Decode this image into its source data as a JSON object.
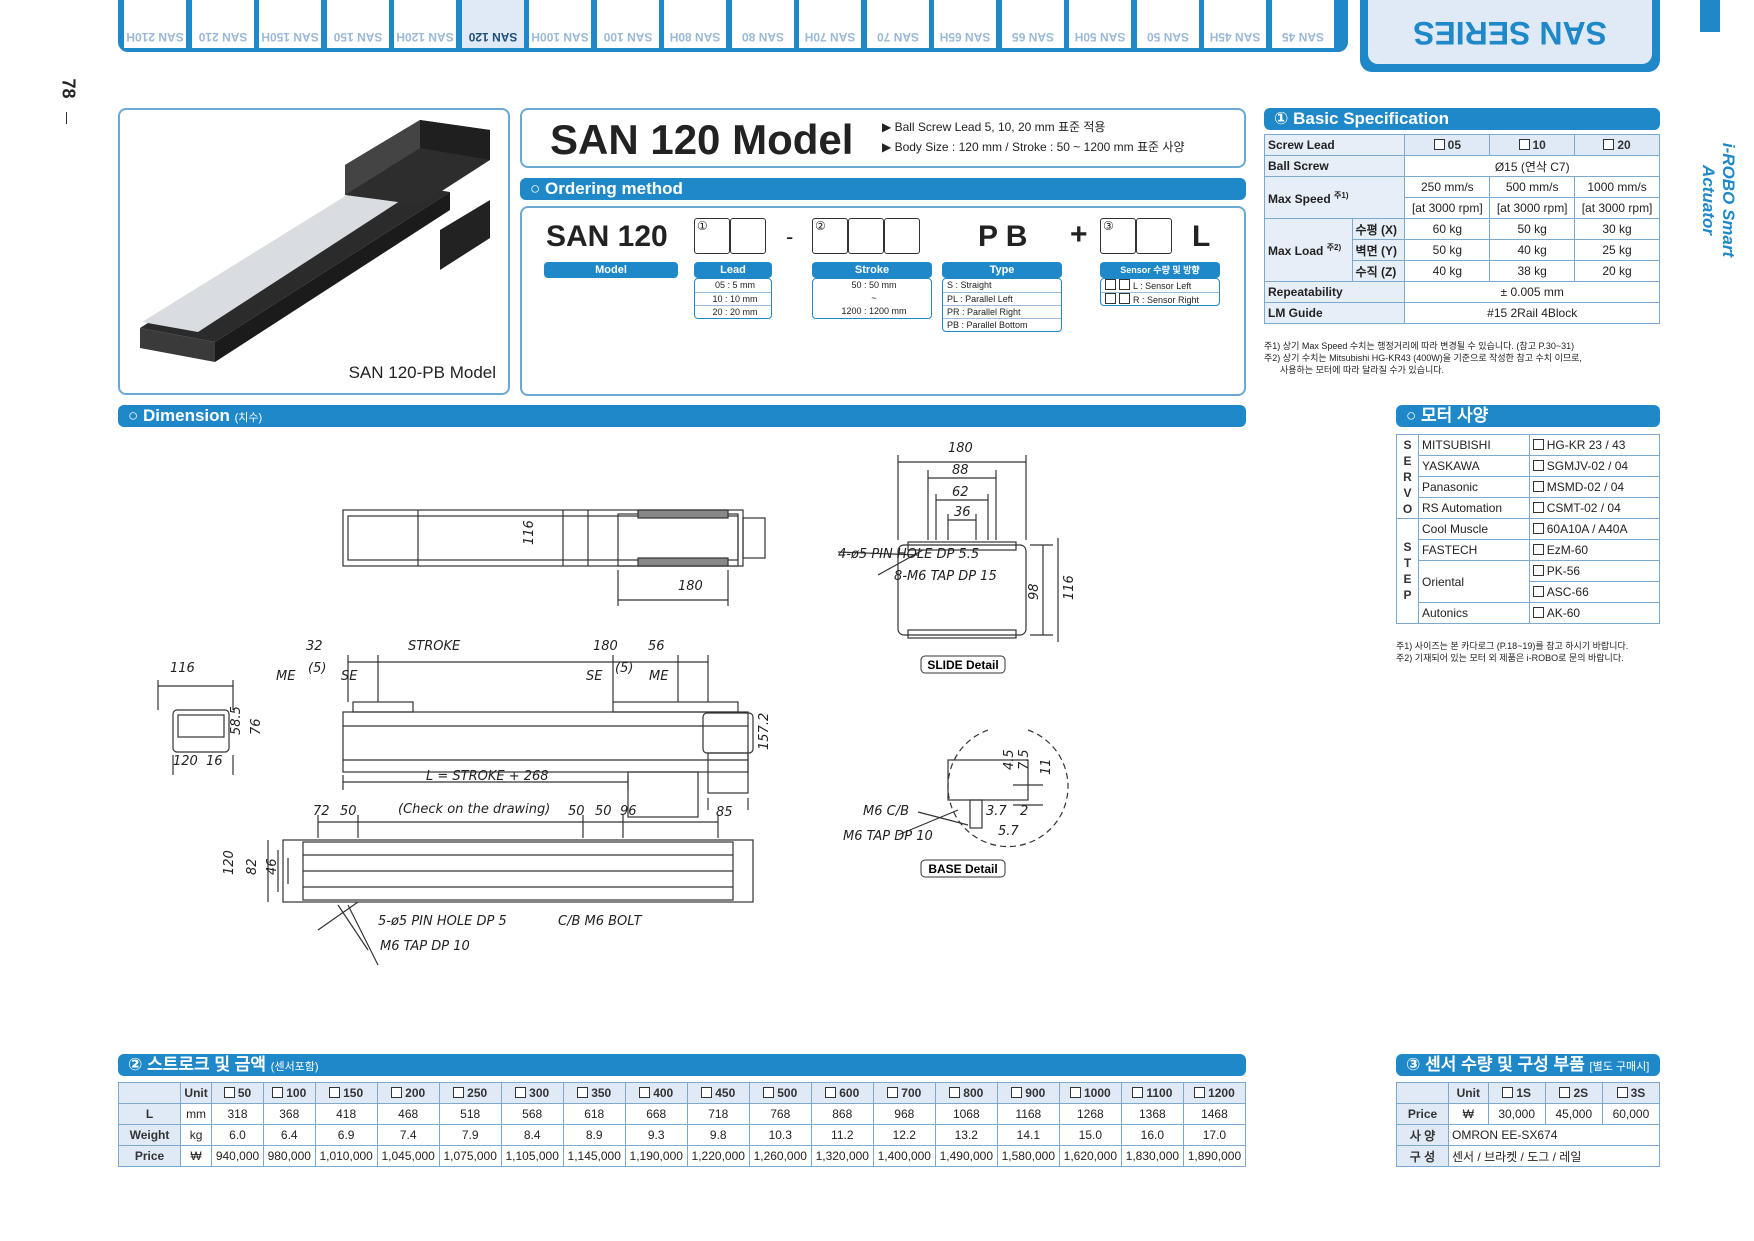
{
  "page_number": "78",
  "side_brand": "i-ROBO Smart Actuator",
  "series_banner": "SAN SERIES",
  "series_strip_label": "SAN SERIES",
  "tabs": [
    "SAN 210H",
    "SAN 210",
    "SAN 150H",
    "SAN 150",
    "SAN 120H",
    "SAN 120",
    "SAN 100H",
    "SAN 100",
    "SAN 80H",
    "SAN 80",
    "SAN 70H",
    "SAN 70",
    "SAN 65H",
    "SAN 65",
    "SAN 50H",
    "SAN 50",
    "SAN 45H",
    "SAN 45"
  ],
  "active_tab": "SAN 120",
  "product_caption": "SAN 120-PB Model",
  "model_title": "SAN 120 Model",
  "model_notes": [
    "▶ Ball Screw Lead 5, 10, 20 mm 표준 적용",
    "▶ Body Size : 120 mm / Stroke : 50 ~ 1200 mm 표준 사양"
  ],
  "ordering": {
    "title": "Ordering method",
    "code_prefix": "SAN 120",
    "dash": "-",
    "type_code": "P B",
    "plus": "+",
    "suffix": "L",
    "circle1": "①",
    "circle2": "②",
    "circle3": "③",
    "labels": {
      "model": "Model",
      "lead": "Lead",
      "stroke": "Stroke",
      "type": "Type",
      "sensor": "Sensor 수량 및 방향"
    },
    "lead_options": [
      "05 : 5 mm",
      "10 : 10 mm",
      "20 : 20 mm"
    ],
    "stroke_options": [
      "50 : 50 mm",
      "~",
      "1200 : 1200 mm"
    ],
    "type_options": [
      "S : Straight",
      "PL : Parallel Left",
      "PR : Parallel Right",
      "PB : Parallel Bottom"
    ],
    "sensor_options": [
      "L : Sensor Left",
      "R : Sensor Right"
    ]
  },
  "basic_spec": {
    "title": "① Basic Specification",
    "screw_lead_label": "Screw Lead",
    "leads": [
      "05",
      "10",
      "20"
    ],
    "ball_screw_label": "Ball Screw",
    "ball_screw": "Ø15 (연삭 C7)",
    "max_speed_label": "Max Speed",
    "max_speed_note": "주1)",
    "max_speed": [
      "250 mm/s",
      "500 mm/s",
      "1000 mm/s"
    ],
    "max_speed_rpm": [
      "[at 3000 rpm]",
      "[at 3000 rpm]",
      "[at 3000 rpm]"
    ],
    "max_load_label": "Max Load",
    "max_load_note": "주2)",
    "load_rows": [
      {
        "dir": "수평 (X)",
        "values": [
          "60 kg",
          "50 kg",
          "30 kg"
        ]
      },
      {
        "dir": "벽면 (Y)",
        "values": [
          "50 kg",
          "40 kg",
          "25 kg"
        ]
      },
      {
        "dir": "수직 (Z)",
        "values": [
          "40 kg",
          "38 kg",
          "20 kg"
        ]
      }
    ],
    "repeatability_label": "Repeatability",
    "repeatability": "± 0.005 mm",
    "lm_guide_label": "LM Guide",
    "lm_guide": "#15 2Rail 4Block",
    "notes": [
      "주1) 상기 Max Speed 수치는 행정거리에 따라 변경될 수 있습니다. (참고 P.30~31)",
      "주2) 상기 수치는 Mitsubishi HG-KR43 (400W)을 기준으로 작성한 참고 수치 이므로,",
      "사용하는 모터에 따라 달라질 수가 있습니다."
    ]
  },
  "dimension": {
    "title": "Dimension",
    "title_sub": "(치수)",
    "labels": {
      "d116": "116",
      "d180": "180",
      "d32": "32",
      "stroke": "STROKE",
      "d180b": "180",
      "d56": "56",
      "me": "ME",
      "se": "SE",
      "p5": "(5)",
      "d116b": "116",
      "d58": "58.5",
      "d76": "76",
      "d120": "120",
      "d16": "16",
      "l_formula": "L = STROKE + 268",
      "d157": "157.2",
      "d85": "85",
      "d72": "72",
      "d50": "50",
      "check": "(Check on the drawing)",
      "d50b": "50",
      "d50c": "50",
      "d96": "96",
      "d120b": "120",
      "d82": "82",
      "d46": "46",
      "pin_hole5": "5-ø5 PIN HOLE DP 5",
      "cb_bolt": "C/B M6 BOLT",
      "m6_tap": "M6 TAP DP 10",
      "pin_hole4": "4-ø5 PIN HOLE DP 5.5",
      "m6_tap8": "8-M6 TAP DP 15",
      "s180": "180",
      "s88": "88",
      "s62": "62",
      "s36": "36",
      "s98": "98",
      "s116": "116",
      "slide_detail": "SLIDE Detail",
      "m6_cb": "M6 C/B",
      "m6_tap10": "M6 TAP DP 10",
      "b37": "3.7",
      "b2": "2",
      "b57": "5.7",
      "b45": "4.5",
      "b75": "7.5",
      "b11": "11",
      "base_detail": "BASE Detail"
    }
  },
  "motor": {
    "title": "모터 사양",
    "servo_letters": [
      "S",
      "E",
      "R",
      "V",
      "O"
    ],
    "step_letters": [
      "S",
      "T",
      "E",
      "P"
    ],
    "servo": [
      {
        "brand": "MITSUBISHI",
        "model": "HG-KR 23 / 43"
      },
      {
        "brand": "YASKAWA",
        "model": "SGMJV-02 / 04"
      },
      {
        "brand": "Panasonic",
        "model": "MSMD-02 / 04"
      },
      {
        "brand": "RS Automation",
        "model": "CSMT-02 / 04"
      }
    ],
    "step": [
      {
        "brand": "Cool Muscle",
        "models": [
          "60A10A / A40A"
        ]
      },
      {
        "brand": "FASTECH",
        "models": [
          "EzM-60"
        ]
      },
      {
        "brand": "Oriental",
        "models": [
          "PK-56",
          "ASC-66"
        ]
      },
      {
        "brand": "Autonics",
        "models": [
          "AK-60"
        ]
      }
    ],
    "notes": [
      "주1) 사이즈는 본 카다로그 (P.18~19)를 참고 하시기 바랍니다.",
      "주2) 기재되어 있는 모터 외 제품은 i-ROBO로 문의 바랍니다."
    ]
  },
  "stroke_price": {
    "title": "② 스트로크 및 금액",
    "title_sub": "(센서포함)",
    "unit_label": "Unit",
    "strokes": [
      "50",
      "100",
      "150",
      "200",
      "250",
      "300",
      "350",
      "400",
      "450",
      "500",
      "600",
      "700",
      "800",
      "900",
      "1000",
      "1100",
      "1200"
    ],
    "rows": [
      {
        "label": "L",
        "unit": "mm",
        "values": [
          "318",
          "368",
          "418",
          "468",
          "518",
          "568",
          "618",
          "668",
          "718",
          "768",
          "868",
          "968",
          "1068",
          "1168",
          "1268",
          "1368",
          "1468"
        ]
      },
      {
        "label": "Weight",
        "unit": "kg",
        "values": [
          "6.0",
          "6.4",
          "6.9",
          "7.4",
          "7.9",
          "8.4",
          "8.9",
          "9.3",
          "9.8",
          "10.3",
          "11.2",
          "12.2",
          "13.2",
          "14.1",
          "15.0",
          "16.0",
          "17.0"
        ]
      },
      {
        "label": "Price",
        "unit": "₩",
        "values": [
          "940,000",
          "980,000",
          "1,010,000",
          "1,045,000",
          "1,075,000",
          "1,105,000",
          "1,145,000",
          "1,190,000",
          "1,220,000",
          "1,260,000",
          "1,320,000",
          "1,400,000",
          "1,490,000",
          "1,580,000",
          "1,620,000",
          "1,830,000",
          "1,890,000"
        ]
      }
    ]
  },
  "sensor": {
    "title": "③ 센서 수량 및 구성 부품",
    "title_sub": "[별도 구매시]",
    "unit_label": "Unit",
    "options": [
      "1S",
      "2S",
      "3S"
    ],
    "price_label": "Price",
    "price_unit": "₩",
    "prices": [
      "30,000",
      "45,000",
      "60,000"
    ],
    "spec_label": "사 양",
    "spec": "OMRON   EE-SX674",
    "compose_label": "구 성",
    "compose": "센서 / 브라켓 / 도그 / 레일"
  },
  "colors": {
    "accent": "#1e88c8",
    "header_bg": "#dfeaf6"
  }
}
